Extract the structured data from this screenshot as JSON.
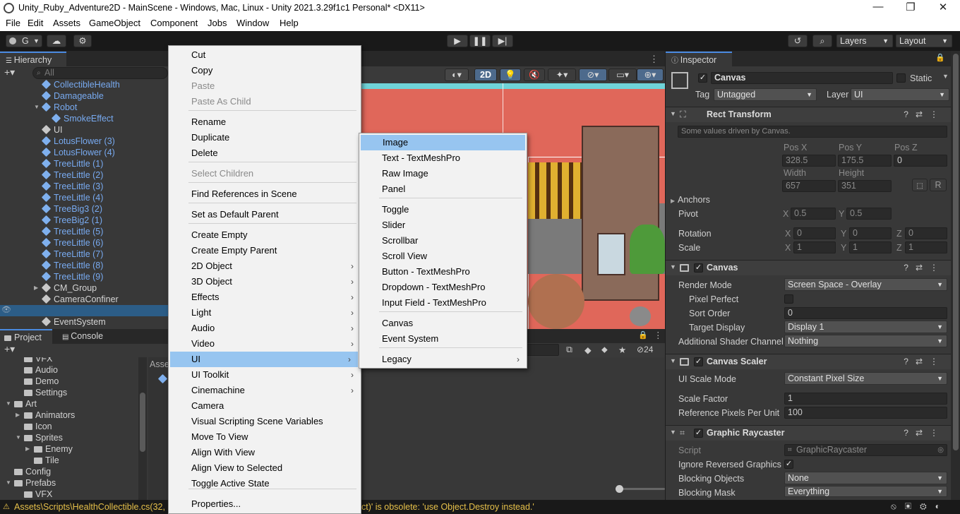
{
  "titlebar": {
    "title": "Unity_Ruby_Adventure2D - MainScene - Windows, Mac, Linux - Unity 2021.3.29f1c1 Personal* <DX11>",
    "minimize": "—",
    "maximize": "❐",
    "close": "✕"
  },
  "menubar": [
    "File",
    "Edit",
    "Assets",
    "GameObject",
    "Component",
    "Jobs",
    "Window",
    "Help"
  ],
  "toolbar": {
    "account": "G",
    "layers": "Layers",
    "layout": "Layout"
  },
  "hierarchy": {
    "tab": "Hierarchy",
    "search_placeholder": "All",
    "items": [
      {
        "label": "CollectibleHealth",
        "kind": "prefab"
      },
      {
        "label": "Damageable",
        "kind": "prefab"
      },
      {
        "label": "Robot",
        "kind": "prefab"
      },
      {
        "label": "SmokeEffect",
        "kind": "prefab"
      },
      {
        "label": "UI",
        "kind": "object"
      },
      {
        "label": "LotusFlower (3)",
        "kind": "prefab"
      },
      {
        "label": "LotusFlower (4)",
        "kind": "prefab"
      },
      {
        "label": "TreeLittle (1)",
        "kind": "prefab"
      },
      {
        "label": "TreeLittle (2)",
        "kind": "prefab"
      },
      {
        "label": "TreeLittle (3)",
        "kind": "prefab"
      },
      {
        "label": "TreeLittle (4)",
        "kind": "prefab"
      },
      {
        "label": "TreeBig3 (2)",
        "kind": "prefab"
      },
      {
        "label": "TreeBig2 (1)",
        "kind": "prefab"
      },
      {
        "label": "TreeLittle (5)",
        "kind": "prefab"
      },
      {
        "label": "TreeLittle (6)",
        "kind": "prefab"
      },
      {
        "label": "TreeLittle (7)",
        "kind": "prefab"
      },
      {
        "label": "TreeLittle (8)",
        "kind": "prefab"
      },
      {
        "label": "TreeLittle (9)",
        "kind": "prefab"
      },
      {
        "label": "CM_Group",
        "kind": "object"
      },
      {
        "label": "CameraConfiner",
        "kind": "object"
      },
      {
        "label": "Canvas",
        "kind": "selected"
      },
      {
        "label": "EventSystem",
        "kind": "object"
      }
    ]
  },
  "project": {
    "tabs": [
      "Project",
      "Console"
    ],
    "tree": [
      {
        "label": "VFX",
        "level": 2
      },
      {
        "label": "Audio",
        "level": 2
      },
      {
        "label": "Demo",
        "level": 2
      },
      {
        "label": "Settings",
        "level": 2
      },
      {
        "label": "Art",
        "level": 1
      },
      {
        "label": "Animators",
        "level": 2
      },
      {
        "label": "Icon",
        "level": 2
      },
      {
        "label": "Sprites",
        "level": 2
      },
      {
        "label": "Enemy",
        "level": 3
      },
      {
        "label": "Tile",
        "level": 3
      },
      {
        "label": "Config",
        "level": 1
      },
      {
        "label": "Prefabs",
        "level": 1
      },
      {
        "label": "VFX",
        "level": 2
      }
    ],
    "assets_label": "Asse",
    "hidden_count": "24"
  },
  "scene_toolbar": {
    "mode_2d": "2D"
  },
  "context_menu": {
    "items": [
      {
        "label": "Cut"
      },
      {
        "label": "Copy"
      },
      {
        "label": "Paste",
        "disabled": true
      },
      {
        "label": "Paste As Child",
        "disabled": true
      },
      {
        "label": "Rename"
      },
      {
        "label": "Duplicate"
      },
      {
        "label": "Delete"
      },
      {
        "label": "Select Children",
        "disabled": true
      },
      {
        "label": "Find References in Scene"
      },
      {
        "label": "Set as Default Parent"
      },
      {
        "label": "Create Empty"
      },
      {
        "label": "Create Empty Parent"
      },
      {
        "label": "2D Object",
        "submenu": true
      },
      {
        "label": "3D Object",
        "submenu": true
      },
      {
        "label": "Effects",
        "submenu": true
      },
      {
        "label": "Light",
        "submenu": true
      },
      {
        "label": "Audio",
        "submenu": true
      },
      {
        "label": "Video",
        "submenu": true
      },
      {
        "label": "UI",
        "submenu": true,
        "selected": true
      },
      {
        "label": "UI Toolkit",
        "submenu": true
      },
      {
        "label": "Cinemachine",
        "submenu": true
      },
      {
        "label": "Camera"
      },
      {
        "label": "Visual Scripting Scene Variables"
      },
      {
        "label": "Move To View"
      },
      {
        "label": "Align With View"
      },
      {
        "label": "Align View to Selected"
      },
      {
        "label": "Toggle Active State"
      },
      {
        "label": "Properties..."
      }
    ]
  },
  "ui_submenu": {
    "items": [
      {
        "label": "Image",
        "selected": true
      },
      {
        "label": "Text - TextMeshPro"
      },
      {
        "label": "Raw Image"
      },
      {
        "label": "Panel"
      },
      {
        "label": "Toggle"
      },
      {
        "label": "Slider"
      },
      {
        "label": "Scrollbar"
      },
      {
        "label": "Scroll View"
      },
      {
        "label": "Button - TextMeshPro"
      },
      {
        "label": "Dropdown - TextMeshPro"
      },
      {
        "label": "Input Field - TextMeshPro"
      },
      {
        "label": "Canvas"
      },
      {
        "label": "Event System"
      },
      {
        "label": "Legacy",
        "submenu": true
      }
    ]
  },
  "inspector": {
    "tab": "Inspector",
    "object_name": "Canvas",
    "static_label": "Static",
    "tag_label": "Tag",
    "tag_value": "Untagged",
    "layer_label": "Layer",
    "layer_value": "UI",
    "rect_transform": {
      "title": "Rect Transform",
      "note": "Some values driven by Canvas.",
      "pos_x_label": "Pos X",
      "pos_y_label": "Pos Y",
      "pos_z_label": "Pos Z",
      "pos_x": "328.5",
      "pos_y": "175.5",
      "pos_z": "0",
      "width_label": "Width",
      "height_label": "Height",
      "width": "657",
      "height": "351",
      "r_button": "R",
      "anchors_label": "Anchors",
      "pivot_label": "Pivot",
      "pivot_x": "0.5",
      "pivot_y": "0.5",
      "rotation_label": "Rotation",
      "rot_x": "0",
      "rot_y": "0",
      "rot_z": "0",
      "scale_label": "Scale",
      "scale_x": "1",
      "scale_y": "1",
      "scale_z": "1",
      "x": "X",
      "y": "Y",
      "z": "Z"
    },
    "canvas": {
      "title": "Canvas",
      "render_mode_label": "Render Mode",
      "render_mode": "Screen Space - Overlay",
      "pixel_perfect_label": "Pixel Perfect",
      "sort_order_label": "Sort Order",
      "sort_order": "0",
      "target_display_label": "Target Display",
      "target_display": "Display 1",
      "shader_channel_label": "Additional Shader Channel",
      "shader_channel": "Nothing"
    },
    "canvas_scaler": {
      "title": "Canvas Scaler",
      "scale_mode_label": "UI Scale Mode",
      "scale_mode": "Constant Pixel Size",
      "scale_factor_label": "Scale Factor",
      "scale_factor": "1",
      "ref_ppu_label": "Reference Pixels Per Unit",
      "ref_ppu": "100"
    },
    "graphic_raycaster": {
      "title": "Graphic Raycaster",
      "script_label": "Script",
      "script": "GraphicRaycaster",
      "ignore_label": "Ignore Reversed Graphics",
      "blocking_objects_label": "Blocking Objects",
      "blocking_objects": "None",
      "blocking_mask_label": "Blocking Mask",
      "blocking_mask": "Everything"
    }
  },
  "status": {
    "text": "Assets\\Scripts\\HealthCollectible.cs(32,",
    "text2": "ct)' is obsolete: 'use Object.Destroy instead.'"
  },
  "colors": {
    "accent_selection": "#97c5f0",
    "prefab_blue": "#78aaf0",
    "editor_bg": "#383838",
    "scene_ground": "#e0675a",
    "warning_yellow": "#e6c04a"
  }
}
